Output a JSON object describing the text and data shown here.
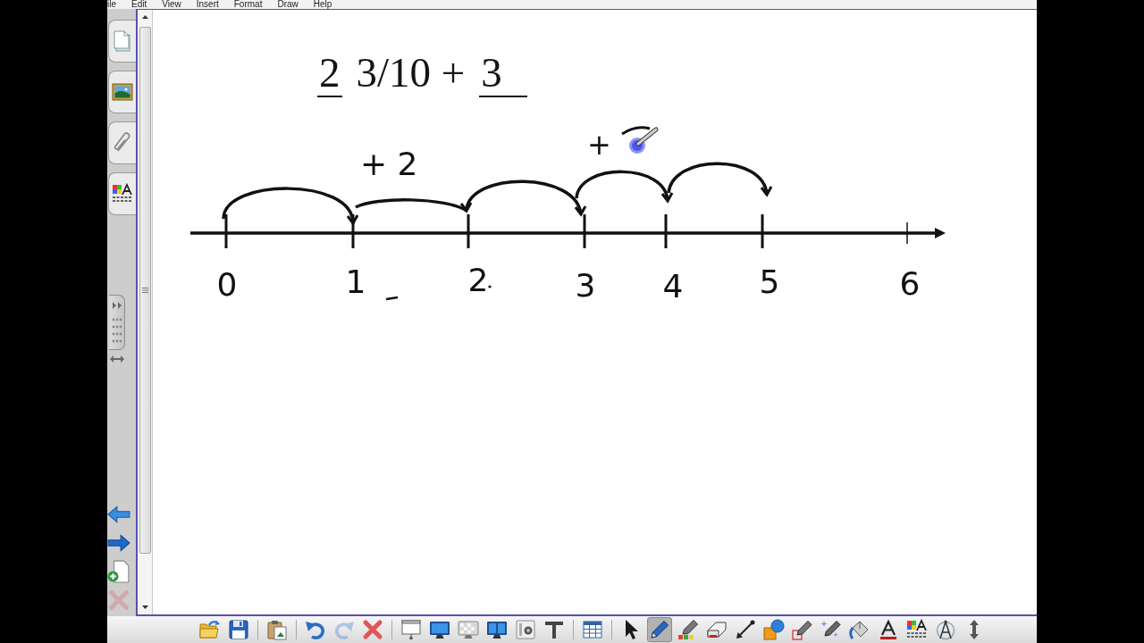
{
  "menu_bar": {
    "items": [
      "ile",
      "Edit",
      "View",
      "Insert",
      "Format",
      "Draw",
      "Help"
    ]
  },
  "page_controls": [
    {
      "kind": "back",
      "disabled": false
    },
    {
      "kind": "forward",
      "disabled": false
    },
    {
      "kind": "add",
      "disabled": false
    },
    {
      "kind": "delete",
      "disabled": true
    }
  ],
  "canvas": {
    "expression": [
      {
        "kind": "filled",
        "text": "2"
      },
      {
        "kind": "plain",
        "text": "3/10 +"
      },
      {
        "kind": "filled",
        "text": "3"
      },
      {
        "kind": "blank"
      }
    ],
    "jump_labels": [
      "+ 2",
      "+"
    ],
    "number_line": {
      "tick_labels": [
        "0",
        "1",
        "2",
        "3",
        "4",
        "5",
        "6"
      ]
    }
  },
  "toolbar": {
    "groups": [
      [
        {
          "kind": "open",
          "selected": false,
          "disabled": false
        },
        {
          "kind": "save",
          "selected": false,
          "disabled": false
        }
      ],
      [
        {
          "kind": "paste",
          "selected": false,
          "disabled": false
        }
      ],
      [
        {
          "kind": "undo",
          "selected": false,
          "disabled": false
        },
        {
          "kind": "redo",
          "selected": false,
          "disabled": true
        },
        {
          "kind": "delete",
          "selected": false,
          "disabled": false
        }
      ],
      [
        {
          "kind": "shade",
          "selected": false,
          "disabled": false
        },
        {
          "kind": "fullscreen",
          "selected": false,
          "disabled": false
        },
        {
          "kind": "transparent",
          "selected": false,
          "disabled": false
        },
        {
          "kind": "dual",
          "selected": false,
          "disabled": false
        },
        {
          "kind": "capture",
          "selected": false,
          "disabled": false
        },
        {
          "kind": "doccam",
          "selected": false,
          "disabled": false
        }
      ],
      [
        {
          "kind": "table",
          "selected": false,
          "disabled": false
        }
      ],
      [
        {
          "kind": "select",
          "selected": false,
          "disabled": false
        },
        {
          "kind": "pen",
          "selected": true,
          "disabled": false
        },
        {
          "kind": "creative",
          "selected": false,
          "disabled": false
        },
        {
          "kind": "eraser",
          "selected": false,
          "disabled": false
        },
        {
          "kind": "line",
          "selected": false,
          "disabled": false
        },
        {
          "kind": "shapes",
          "selected": false,
          "disabled": false
        },
        {
          "kind": "recognition",
          "selected": false,
          "disabled": false
        },
        {
          "kind": "magic",
          "selected": false,
          "disabled": false
        },
        {
          "kind": "fill",
          "selected": false,
          "disabled": false
        },
        {
          "kind": "text",
          "selected": false,
          "disabled": false
        },
        {
          "kind": "properties",
          "selected": false,
          "disabled": false
        },
        {
          "kind": "compass",
          "selected": false,
          "disabled": false
        },
        {
          "kind": "move",
          "selected": false,
          "disabled": false
        }
      ]
    ]
  }
}
